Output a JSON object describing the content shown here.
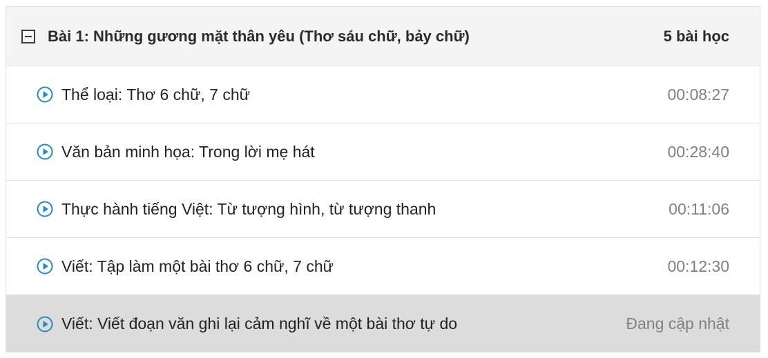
{
  "section": {
    "title": "Bài 1: Những gương mặt thân yêu (Thơ sáu chữ, bảy chữ)",
    "count": "5 bài học",
    "collapse_icon": "minus-square-icon"
  },
  "lessons": [
    {
      "title": "Thể loại: Thơ 6 chữ, 7 chữ",
      "duration": "00:08:27",
      "icon": "play-circle-icon"
    },
    {
      "title": "Văn bản minh họa: Trong lời mẹ hát",
      "duration": "00:28:40",
      "icon": "play-circle-icon"
    },
    {
      "title": "Thực hành tiếng Việt: Từ tượng hình, từ tượng thanh",
      "duration": "00:11:06",
      "icon": "play-circle-icon"
    },
    {
      "title": "Viết: Tập làm một bài thơ 6 chữ, 7 chữ",
      "duration": "00:12:30",
      "icon": "play-circle-icon"
    },
    {
      "title": "Viết: Viết đoạn văn ghi lại cảm nghĩ về một bài thơ tự do",
      "duration": "Đang cập nhật",
      "icon": "play-circle-icon"
    }
  ],
  "colors": {
    "play_icon": "#2a8ab8",
    "header_bg": "#f4f4f4",
    "active_row_bg": "#dcdcdc",
    "duration_text": "#808080"
  }
}
